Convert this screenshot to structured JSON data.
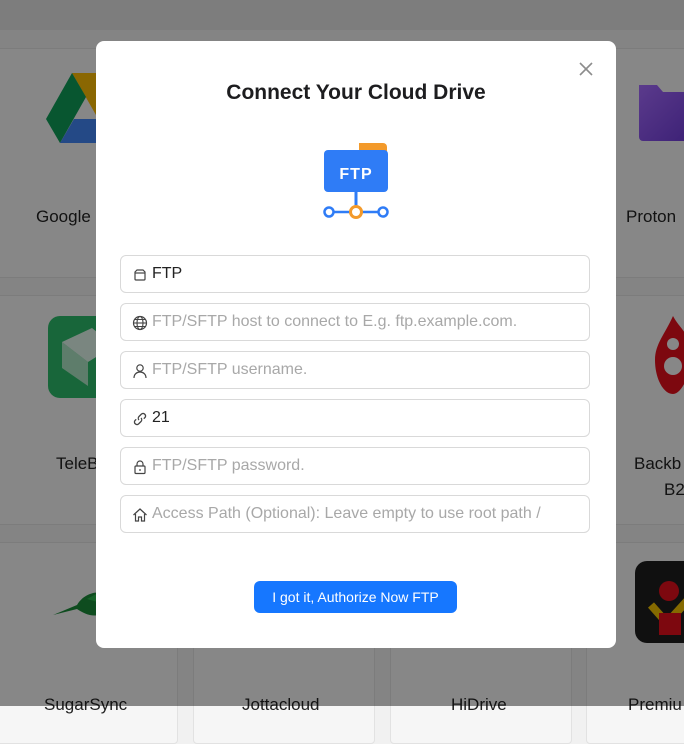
{
  "background": {
    "cards": [
      {
        "label": "Google",
        "icon": "google-drive-icon"
      },
      {
        "label": "Proton",
        "icon": "proton-drive-icon"
      },
      {
        "label": "TeleB",
        "icon": "telebox-icon"
      },
      {
        "label": "Backb",
        "label2": "B2",
        "icon": "backblaze-icon"
      },
      {
        "label": "SugarSync",
        "icon": "hummingbird-icon"
      },
      {
        "label": "Jottacloud",
        "icon": ""
      },
      {
        "label": "HiDrive",
        "icon": ""
      },
      {
        "label": "Premiu",
        "icon": "premiumize-icon"
      }
    ]
  },
  "modal": {
    "title": "Connect Your Cloud Drive",
    "logo_text": "FTP",
    "fields": [
      {
        "icon": "box-icon",
        "value": "FTP",
        "placeholder": ""
      },
      {
        "icon": "globe-icon",
        "value": "",
        "placeholder": "FTP/SFTP host to connect to E.g. ftp.example.com."
      },
      {
        "icon": "user-icon",
        "value": "",
        "placeholder": "FTP/SFTP username."
      },
      {
        "icon": "link-icon",
        "value": "21",
        "placeholder": ""
      },
      {
        "icon": "lock-icon",
        "value": "",
        "placeholder": "FTP/SFTP password."
      },
      {
        "icon": "home-icon",
        "value": "",
        "placeholder": "Access Path (Optional): Leave empty to use root path /"
      }
    ],
    "button_label": "I got it, Authorize Now FTP"
  },
  "colors": {
    "accent": "#1677ff",
    "ftp_blue": "#2f7cf6",
    "ftp_orange": "#f39a2b"
  }
}
